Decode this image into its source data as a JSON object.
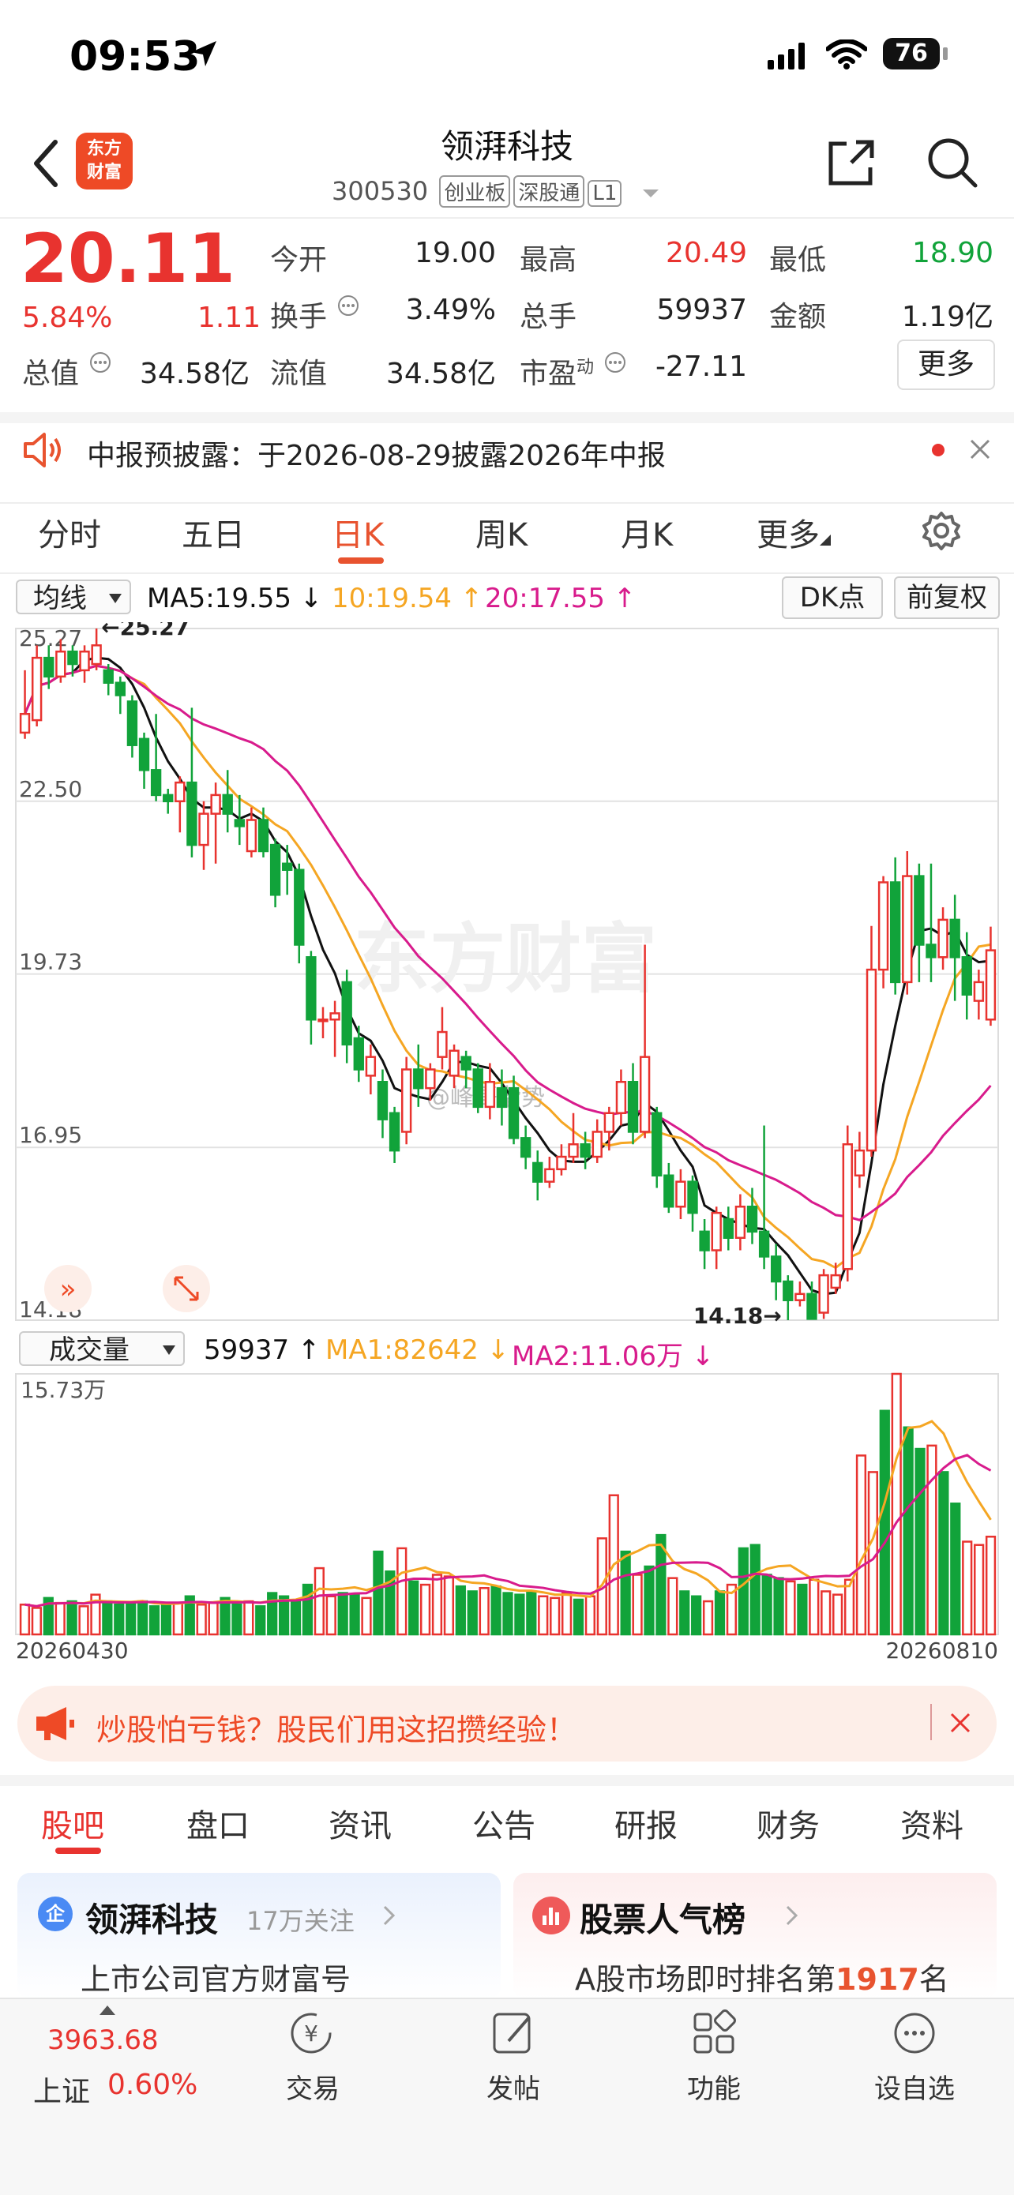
{
  "status_bar": {
    "time": "09:53",
    "battery": "76"
  },
  "header": {
    "logo_text": "东方财富",
    "stock_name": "领湃科技",
    "stock_code": "300530",
    "tags": [
      "创业板",
      "深股通",
      "L1"
    ]
  },
  "quote": {
    "price": "20.11",
    "change_pct": "5.84%",
    "change": "1.11",
    "rows": [
      [
        {
          "label": "今开",
          "value": "19.00",
          "color": "#222222"
        },
        {
          "label": "最高",
          "value": "20.49",
          "color": "#e8332f"
        },
        {
          "label": "最低",
          "value": "18.90",
          "color": "#11a33a"
        }
      ],
      [
        {
          "label": "换手",
          "value": "3.49%",
          "color": "#222222"
        },
        {
          "label": "总手",
          "value": "59937",
          "color": "#222222"
        },
        {
          "label": "金额",
          "value": "1.19亿",
          "color": "#222222"
        }
      ]
    ],
    "row3": [
      {
        "label": "总值",
        "value": "34.58亿"
      },
      {
        "label": "流值",
        "value": "34.58亿"
      },
      {
        "label": "市盈",
        "sup": "动",
        "value": "-27.11"
      }
    ],
    "more_label": "更多"
  },
  "notice": {
    "label": "中报预披露：",
    "text": "于2026-08-29披露2026年中报"
  },
  "chart_tabs": {
    "items": [
      "分时",
      "五日",
      "日K",
      "周K",
      "月K",
      "更多"
    ],
    "active": "日K"
  },
  "kline_controls": {
    "indicator_select": "均线",
    "ma5": "MA5:19.55",
    "ma10": "10:19.54",
    "ma20": "20:17.55",
    "dk_label": "DK点",
    "adjust_label": "前复权"
  },
  "volume_controls": {
    "select": "成交量",
    "vol": "59937",
    "ma1": "MA1:82642",
    "ma2": "MA2:11.06万"
  },
  "watermark": "东方财富",
  "weibo_mark": "@峰哥偕势",
  "colors": {
    "up": "#e8332f",
    "down": "#11a33a",
    "ma5": "#111111",
    "ma10": "#f5a623",
    "ma20": "#d81b8c",
    "accent": "#e8532f"
  },
  "chart_data": [
    {
      "type": "candlestick",
      "title": "",
      "ylim": [
        14.18,
        25.27
      ],
      "y_ticks": [
        "25.27",
        "22.50",
        "19.73",
        "16.95",
        "14.18"
      ],
      "max_marker": "←25.27",
      "min_marker": "14.18→",
      "candles": [
        {
          "o": 23.6,
          "c": 23.9,
          "h": 24.6,
          "l": 23.5
        },
        {
          "o": 23.8,
          "c": 24.8,
          "h": 25.0,
          "l": 23.7
        },
        {
          "o": 24.8,
          "c": 24.5,
          "h": 25.0,
          "l": 24.3
        },
        {
          "o": 24.5,
          "c": 24.9,
          "h": 25.1,
          "l": 24.4
        },
        {
          "o": 24.9,
          "c": 24.7,
          "h": 25.0,
          "l": 24.5
        },
        {
          "o": 24.6,
          "c": 24.9,
          "h": 25.0,
          "l": 24.4
        },
        {
          "o": 24.7,
          "c": 25.0,
          "h": 25.27,
          "l": 24.6
        },
        {
          "o": 24.6,
          "c": 24.4,
          "h": 24.7,
          "l": 24.2
        },
        {
          "o": 24.4,
          "c": 24.2,
          "h": 24.5,
          "l": 23.9
        },
        {
          "o": 24.1,
          "c": 23.4,
          "h": 24.2,
          "l": 23.2
        },
        {
          "o": 23.5,
          "c": 23.0,
          "h": 23.6,
          "l": 22.7
        },
        {
          "o": 23.0,
          "c": 22.6,
          "h": 23.9,
          "l": 22.5
        },
        {
          "o": 22.6,
          "c": 22.5,
          "h": 22.7,
          "l": 22.3
        },
        {
          "o": 22.5,
          "c": 22.8,
          "h": 22.9,
          "l": 22.0
        },
        {
          "o": 22.8,
          "c": 21.8,
          "h": 24.0,
          "l": 21.6
        },
        {
          "o": 21.8,
          "c": 22.3,
          "h": 22.5,
          "l": 21.4
        },
        {
          "o": 22.3,
          "c": 22.6,
          "h": 22.8,
          "l": 21.5
        },
        {
          "o": 22.6,
          "c": 22.3,
          "h": 23.0,
          "l": 22.0
        },
        {
          "o": 22.2,
          "c": 22.1,
          "h": 22.6,
          "l": 21.8
        },
        {
          "o": 21.7,
          "c": 22.2,
          "h": 22.4,
          "l": 21.6
        },
        {
          "o": 22.2,
          "c": 21.7,
          "h": 22.4,
          "l": 21.6
        },
        {
          "o": 21.8,
          "c": 21.0,
          "h": 21.9,
          "l": 20.8
        },
        {
          "o": 21.5,
          "c": 21.4,
          "h": 21.8,
          "l": 21.0
        },
        {
          "o": 21.4,
          "c": 20.2,
          "h": 21.5,
          "l": 19.9
        },
        {
          "o": 20.0,
          "c": 19.0,
          "h": 20.1,
          "l": 18.6
        },
        {
          "o": 19.0,
          "c": 19.0,
          "h": 19.2,
          "l": 18.7
        },
        {
          "o": 19.0,
          "c": 19.1,
          "h": 19.3,
          "l": 18.4
        },
        {
          "o": 19.6,
          "c": 18.6,
          "h": 19.8,
          "l": 18.3
        },
        {
          "o": 18.7,
          "c": 18.2,
          "h": 18.9,
          "l": 18.0
        },
        {
          "o": 18.1,
          "c": 18.4,
          "h": 18.6,
          "l": 17.8
        },
        {
          "o": 18.0,
          "c": 17.4,
          "h": 18.2,
          "l": 17.1
        },
        {
          "o": 17.5,
          "c": 16.9,
          "h": 17.6,
          "l": 16.7
        },
        {
          "o": 17.2,
          "c": 18.2,
          "h": 18.4,
          "l": 17.0
        },
        {
          "o": 18.2,
          "c": 17.9,
          "h": 18.6,
          "l": 17.6
        },
        {
          "o": 17.9,
          "c": 18.2,
          "h": 18.3,
          "l": 17.7
        },
        {
          "o": 18.4,
          "c": 18.8,
          "h": 19.2,
          "l": 18.2
        },
        {
          "o": 18.1,
          "c": 18.5,
          "h": 18.6,
          "l": 17.9
        },
        {
          "o": 18.4,
          "c": 18.2,
          "h": 18.5,
          "l": 17.9
        },
        {
          "o": 18.2,
          "c": 17.6,
          "h": 18.3,
          "l": 17.5
        },
        {
          "o": 17.6,
          "c": 18.0,
          "h": 18.3,
          "l": 17.4
        },
        {
          "o": 17.9,
          "c": 17.6,
          "h": 18.2,
          "l": 17.3
        },
        {
          "o": 17.9,
          "c": 17.1,
          "h": 18.1,
          "l": 17.0
        },
        {
          "o": 17.1,
          "c": 16.8,
          "h": 17.3,
          "l": 16.6
        },
        {
          "o": 16.7,
          "c": 16.4,
          "h": 16.9,
          "l": 16.1
        },
        {
          "o": 16.4,
          "c": 16.6,
          "h": 16.8,
          "l": 16.3
        },
        {
          "o": 16.6,
          "c": 16.8,
          "h": 17.0,
          "l": 16.5
        },
        {
          "o": 16.8,
          "c": 17.0,
          "h": 17.5,
          "l": 16.7
        },
        {
          "o": 17.0,
          "c": 16.8,
          "h": 17.2,
          "l": 16.6
        },
        {
          "o": 16.8,
          "c": 17.2,
          "h": 17.4,
          "l": 16.7
        },
        {
          "o": 17.2,
          "c": 17.5,
          "h": 17.6,
          "l": 16.9
        },
        {
          "o": 17.5,
          "c": 18.0,
          "h": 18.2,
          "l": 17.3
        },
        {
          "o": 18.0,
          "c": 17.2,
          "h": 18.3,
          "l": 17.0
        },
        {
          "o": 17.2,
          "c": 18.4,
          "h": 20.2,
          "l": 17.1
        },
        {
          "o": 17.5,
          "c": 16.5,
          "h": 17.6,
          "l": 16.3
        },
        {
          "o": 16.5,
          "c": 16.0,
          "h": 16.7,
          "l": 15.9
        },
        {
          "o": 16.0,
          "c": 16.4,
          "h": 16.6,
          "l": 15.8
        },
        {
          "o": 16.4,
          "c": 15.9,
          "h": 16.5,
          "l": 15.6
        },
        {
          "o": 15.6,
          "c": 15.3,
          "h": 15.8,
          "l": 15.0
        },
        {
          "o": 15.3,
          "c": 15.9,
          "h": 16.0,
          "l": 15.0
        },
        {
          "o": 15.8,
          "c": 15.5,
          "h": 16.0,
          "l": 15.3
        },
        {
          "o": 15.5,
          "c": 16.0,
          "h": 16.2,
          "l": 15.3
        },
        {
          "o": 16.0,
          "c": 15.6,
          "h": 16.3,
          "l": 15.4
        },
        {
          "o": 15.6,
          "c": 15.2,
          "h": 17.3,
          "l": 15.0
        },
        {
          "o": 15.2,
          "c": 14.8,
          "h": 15.4,
          "l": 14.5
        },
        {
          "o": 14.8,
          "c": 14.5,
          "h": 14.9,
          "l": 14.18
        },
        {
          "o": 14.5,
          "c": 14.6,
          "h": 14.8,
          "l": 14.4
        },
        {
          "o": 14.6,
          "c": 14.2,
          "h": 14.8,
          "l": 14.3
        },
        {
          "o": 14.3,
          "c": 14.9,
          "h": 15.0,
          "l": 14.2
        },
        {
          "o": 14.7,
          "c": 14.9,
          "h": 15.1,
          "l": 14.6
        },
        {
          "o": 15.0,
          "c": 17.0,
          "h": 17.3,
          "l": 14.8
        },
        {
          "o": 16.5,
          "c": 16.9,
          "h": 17.2,
          "l": 16.3
        },
        {
          "o": 16.9,
          "c": 19.8,
          "h": 20.5,
          "l": 16.8
        },
        {
          "o": 19.8,
          "c": 21.2,
          "h": 21.3,
          "l": 19.5
        },
        {
          "o": 21.2,
          "c": 19.6,
          "h": 21.6,
          "l": 19.4
        },
        {
          "o": 19.6,
          "c": 21.3,
          "h": 21.7,
          "l": 19.4
        },
        {
          "o": 21.3,
          "c": 20.2,
          "h": 21.5,
          "l": 19.6
        },
        {
          "o": 20.2,
          "c": 20.0,
          "h": 21.5,
          "l": 19.6
        },
        {
          "o": 20.0,
          "c": 20.6,
          "h": 20.8,
          "l": 19.8
        },
        {
          "o": 20.6,
          "c": 20.0,
          "h": 21.0,
          "l": 19.3
        },
        {
          "o": 20.0,
          "c": 19.4,
          "h": 20.4,
          "l": 19.0
        },
        {
          "o": 19.3,
          "c": 19.6,
          "h": 19.8,
          "l": 19.0
        },
        {
          "o": 19.0,
          "c": 20.11,
          "h": 20.49,
          "l": 18.9
        }
      ]
    },
    {
      "type": "bar",
      "title": "",
      "ylim": [
        0,
        15.73
      ],
      "y_label": "15.73万",
      "x_start": "20260430",
      "x_end": "20260810",
      "values": [
        1.8,
        1.6,
        2.2,
        1.9,
        2.0,
        1.7,
        2.4,
        2.0,
        1.8,
        1.9,
        2.0,
        1.7,
        1.8,
        1.9,
        2.3,
        1.8,
        1.9,
        2.2,
        1.8,
        2.0,
        1.7,
        2.5,
        2.3,
        2.0,
        3.0,
        4.0,
        2.3,
        2.5,
        2.4,
        2.2,
        5.0,
        3.8,
        5.2,
        3.2,
        3.0,
        3.6,
        3.5,
        2.9,
        2.6,
        2.8,
        2.9,
        2.5,
        2.4,
        2.6,
        2.3,
        2.2,
        2.5,
        2.1,
        2.3,
        5.8,
        8.4,
        5.0,
        3.6,
        4.1,
        6.0,
        3.4,
        2.6,
        2.3,
        2.0,
        2.6,
        3.0,
        5.2,
        5.4,
        3.6,
        3.4,
        3.2,
        3.0,
        3.3,
        2.6,
        2.4,
        3.3,
        10.8,
        9.8,
        13.5,
        15.73,
        12.5,
        11.2,
        11.4,
        9.8,
        7.9,
        5.6,
        5.4,
        5.9
      ],
      "legend": [
        "MA1:82642",
        "MA2:11.06万"
      ]
    }
  ],
  "ad_banner": {
    "text": "炒股怕亏钱？股民们用这招攒经验！"
  },
  "bottom_tabs": {
    "items": [
      "股吧",
      "盘口",
      "资讯",
      "公告",
      "研报",
      "财务",
      "资料"
    ],
    "active": "股吧"
  },
  "cards": [
    {
      "badge": "企",
      "title": "领湃科技",
      "meta": "17万关注",
      "sub": "上市公司官方财富号"
    },
    {
      "title": "股票人气榜",
      "sub_prefix": "A股市场即时排名第",
      "rank": "1917",
      "sub_suffix": "名"
    }
  ],
  "dock": {
    "index_value": "3963.68",
    "index_name": "上证",
    "index_change": "0.60%",
    "items": [
      "交易",
      "发帖",
      "功能",
      "设自选"
    ]
  }
}
